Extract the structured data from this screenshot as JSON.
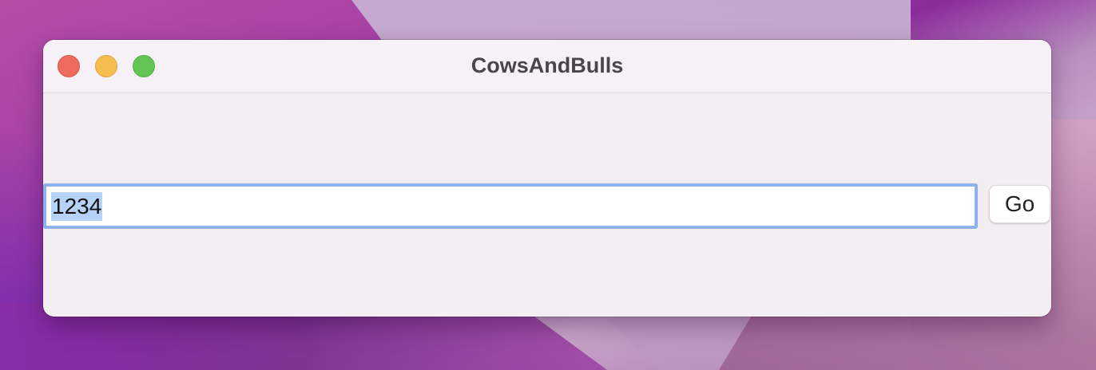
{
  "window": {
    "title": "CowsAndBulls"
  },
  "traffic_lights": {
    "close_color": "#ee6a5f",
    "minimize_color": "#f5be4f",
    "zoom_color": "#62c554"
  },
  "form": {
    "guess_value": "1234",
    "guess_selected": true,
    "go_label": "Go"
  },
  "colors": {
    "focus_ring": "#8fb0ee",
    "selection": "#b7d2f7",
    "window_bg": "#f2eef2"
  }
}
